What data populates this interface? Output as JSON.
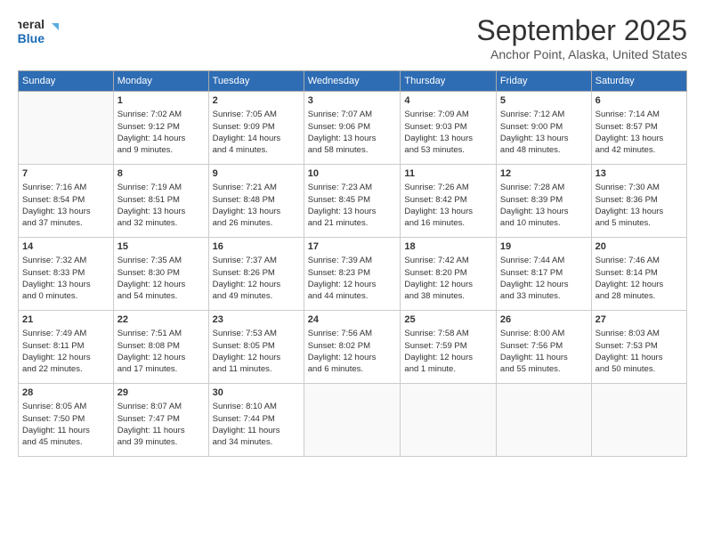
{
  "logo": {
    "line1": "General",
    "line2": "Blue"
  },
  "title": "September 2025",
  "subtitle": "Anchor Point, Alaska, United States",
  "days_of_week": [
    "Sunday",
    "Monday",
    "Tuesday",
    "Wednesday",
    "Thursday",
    "Friday",
    "Saturday"
  ],
  "weeks": [
    [
      {
        "day": "",
        "content": ""
      },
      {
        "day": "1",
        "content": "Sunrise: 7:02 AM\nSunset: 9:12 PM\nDaylight: 14 hours\nand 9 minutes."
      },
      {
        "day": "2",
        "content": "Sunrise: 7:05 AM\nSunset: 9:09 PM\nDaylight: 14 hours\nand 4 minutes."
      },
      {
        "day": "3",
        "content": "Sunrise: 7:07 AM\nSunset: 9:06 PM\nDaylight: 13 hours\nand 58 minutes."
      },
      {
        "day": "4",
        "content": "Sunrise: 7:09 AM\nSunset: 9:03 PM\nDaylight: 13 hours\nand 53 minutes."
      },
      {
        "day": "5",
        "content": "Sunrise: 7:12 AM\nSunset: 9:00 PM\nDaylight: 13 hours\nand 48 minutes."
      },
      {
        "day": "6",
        "content": "Sunrise: 7:14 AM\nSunset: 8:57 PM\nDaylight: 13 hours\nand 42 minutes."
      }
    ],
    [
      {
        "day": "7",
        "content": "Sunrise: 7:16 AM\nSunset: 8:54 PM\nDaylight: 13 hours\nand 37 minutes."
      },
      {
        "day": "8",
        "content": "Sunrise: 7:19 AM\nSunset: 8:51 PM\nDaylight: 13 hours\nand 32 minutes."
      },
      {
        "day": "9",
        "content": "Sunrise: 7:21 AM\nSunset: 8:48 PM\nDaylight: 13 hours\nand 26 minutes."
      },
      {
        "day": "10",
        "content": "Sunrise: 7:23 AM\nSunset: 8:45 PM\nDaylight: 13 hours\nand 21 minutes."
      },
      {
        "day": "11",
        "content": "Sunrise: 7:26 AM\nSunset: 8:42 PM\nDaylight: 13 hours\nand 16 minutes."
      },
      {
        "day": "12",
        "content": "Sunrise: 7:28 AM\nSunset: 8:39 PM\nDaylight: 13 hours\nand 10 minutes."
      },
      {
        "day": "13",
        "content": "Sunrise: 7:30 AM\nSunset: 8:36 PM\nDaylight: 13 hours\nand 5 minutes."
      }
    ],
    [
      {
        "day": "14",
        "content": "Sunrise: 7:32 AM\nSunset: 8:33 PM\nDaylight: 13 hours\nand 0 minutes."
      },
      {
        "day": "15",
        "content": "Sunrise: 7:35 AM\nSunset: 8:30 PM\nDaylight: 12 hours\nand 54 minutes."
      },
      {
        "day": "16",
        "content": "Sunrise: 7:37 AM\nSunset: 8:26 PM\nDaylight: 12 hours\nand 49 minutes."
      },
      {
        "day": "17",
        "content": "Sunrise: 7:39 AM\nSunset: 8:23 PM\nDaylight: 12 hours\nand 44 minutes."
      },
      {
        "day": "18",
        "content": "Sunrise: 7:42 AM\nSunset: 8:20 PM\nDaylight: 12 hours\nand 38 minutes."
      },
      {
        "day": "19",
        "content": "Sunrise: 7:44 AM\nSunset: 8:17 PM\nDaylight: 12 hours\nand 33 minutes."
      },
      {
        "day": "20",
        "content": "Sunrise: 7:46 AM\nSunset: 8:14 PM\nDaylight: 12 hours\nand 28 minutes."
      }
    ],
    [
      {
        "day": "21",
        "content": "Sunrise: 7:49 AM\nSunset: 8:11 PM\nDaylight: 12 hours\nand 22 minutes."
      },
      {
        "day": "22",
        "content": "Sunrise: 7:51 AM\nSunset: 8:08 PM\nDaylight: 12 hours\nand 17 minutes."
      },
      {
        "day": "23",
        "content": "Sunrise: 7:53 AM\nSunset: 8:05 PM\nDaylight: 12 hours\nand 11 minutes."
      },
      {
        "day": "24",
        "content": "Sunrise: 7:56 AM\nSunset: 8:02 PM\nDaylight: 12 hours\nand 6 minutes."
      },
      {
        "day": "25",
        "content": "Sunrise: 7:58 AM\nSunset: 7:59 PM\nDaylight: 12 hours\nand 1 minute."
      },
      {
        "day": "26",
        "content": "Sunrise: 8:00 AM\nSunset: 7:56 PM\nDaylight: 11 hours\nand 55 minutes."
      },
      {
        "day": "27",
        "content": "Sunrise: 8:03 AM\nSunset: 7:53 PM\nDaylight: 11 hours\nand 50 minutes."
      }
    ],
    [
      {
        "day": "28",
        "content": "Sunrise: 8:05 AM\nSunset: 7:50 PM\nDaylight: 11 hours\nand 45 minutes."
      },
      {
        "day": "29",
        "content": "Sunrise: 8:07 AM\nSunset: 7:47 PM\nDaylight: 11 hours\nand 39 minutes."
      },
      {
        "day": "30",
        "content": "Sunrise: 8:10 AM\nSunset: 7:44 PM\nDaylight: 11 hours\nand 34 minutes."
      },
      {
        "day": "",
        "content": ""
      },
      {
        "day": "",
        "content": ""
      },
      {
        "day": "",
        "content": ""
      },
      {
        "day": "",
        "content": ""
      }
    ]
  ]
}
